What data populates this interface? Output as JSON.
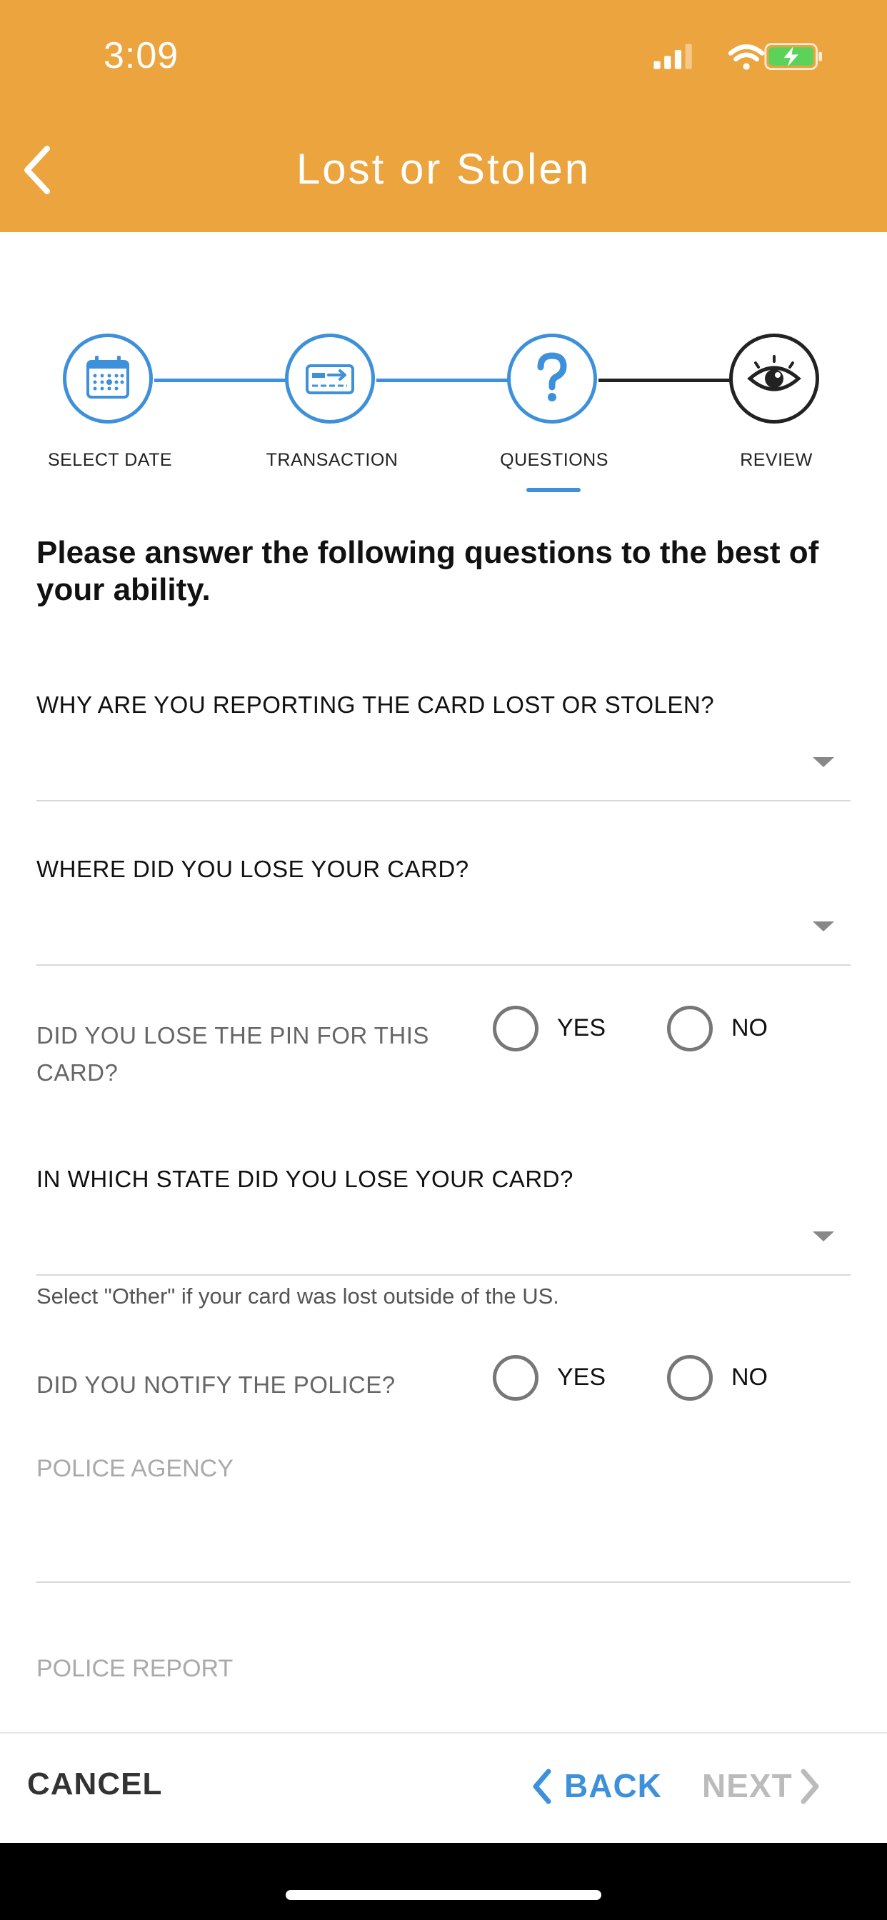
{
  "status_bar": {
    "time": "3:09"
  },
  "header": {
    "title": "Lost or Stolen"
  },
  "steps": [
    {
      "label": "SELECT DATE",
      "icon": "calendar-icon",
      "state": "complete"
    },
    {
      "label": "TRANSACTION",
      "icon": "card-transfer-icon",
      "state": "complete"
    },
    {
      "label": "QUESTIONS",
      "icon": "question-icon",
      "state": "active"
    },
    {
      "label": "REVIEW",
      "icon": "eye-icon",
      "state": "pending"
    }
  ],
  "intro": "Please answer the following questions to the best of your ability.",
  "questions": {
    "reason": {
      "label": "WHY ARE YOU REPORTING THE CARD LOST OR STOLEN?",
      "value": ""
    },
    "where": {
      "label": "WHERE DID YOU LOSE YOUR CARD?",
      "value": ""
    },
    "pin": {
      "label_line1": "DID YOU LOSE THE PIN FOR THIS",
      "label_line2": "CARD?",
      "yes": "YES",
      "no": "NO",
      "selected": null
    },
    "state": {
      "label": "IN WHICH STATE DID YOU LOSE YOUR CARD?",
      "value": "",
      "hint": "Select \"Other\" if your card was lost outside of the US."
    },
    "police": {
      "label": "DID YOU NOTIFY THE POLICE?",
      "yes": "YES",
      "no": "NO",
      "selected": null
    },
    "police_agency": {
      "label": "POLICE AGENCY",
      "value": ""
    },
    "police_report": {
      "label": "POLICE REPORT",
      "value": ""
    }
  },
  "footer": {
    "cancel": "CANCEL",
    "back": "BACK",
    "next": "NEXT"
  },
  "colors": {
    "header": "#ECA43F",
    "accent": "#3D90DA",
    "disabled": "#BBBBBB"
  }
}
